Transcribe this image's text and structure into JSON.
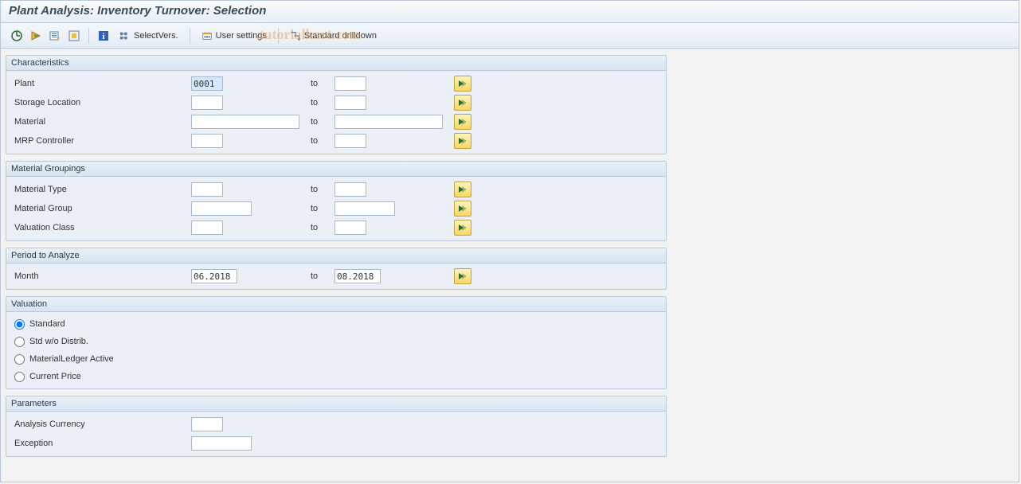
{
  "title": "Plant Analysis: Inventory Turnover: Selection",
  "toolbar": {
    "selectvers": "SelectVers.",
    "user_settings": "User settings",
    "standard_drilldown": "Standard drilldown"
  },
  "watermark": ".tutorialkart.com",
  "groups": {
    "characteristics": {
      "title": "Characteristics",
      "plant": {
        "label": "Plant",
        "from": "0001",
        "to_label": "to",
        "to": ""
      },
      "storage_location": {
        "label": "Storage Location",
        "from": "",
        "to_label": "to",
        "to": ""
      },
      "material": {
        "label": "Material",
        "from": "",
        "to_label": "to",
        "to": ""
      },
      "mrp_controller": {
        "label": "MRP Controller",
        "from": "",
        "to_label": "to",
        "to": ""
      }
    },
    "material_groupings": {
      "title": "Material Groupings",
      "material_type": {
        "label": "Material Type",
        "from": "",
        "to_label": "to",
        "to": ""
      },
      "material_group": {
        "label": "Material Group",
        "from": "",
        "to_label": "to",
        "to": ""
      },
      "valuation_class": {
        "label": "Valuation Class",
        "from": "",
        "to_label": "to",
        "to": ""
      }
    },
    "period": {
      "title": "Period to Analyze",
      "month": {
        "label": "Month",
        "from": "06.2018",
        "to_label": "to",
        "to": "08.2018"
      }
    },
    "valuation": {
      "title": "Valuation",
      "options": {
        "standard": "Standard",
        "std_wo_distrib": "Std w/o Distrib.",
        "ml_active": "MaterialLedger Active",
        "current_price": "Current Price"
      },
      "selected": "standard"
    },
    "parameters": {
      "title": "Parameters",
      "analysis_currency": {
        "label": "Analysis Currency",
        "value": ""
      },
      "exception": {
        "label": "Exception",
        "value": ""
      }
    }
  }
}
